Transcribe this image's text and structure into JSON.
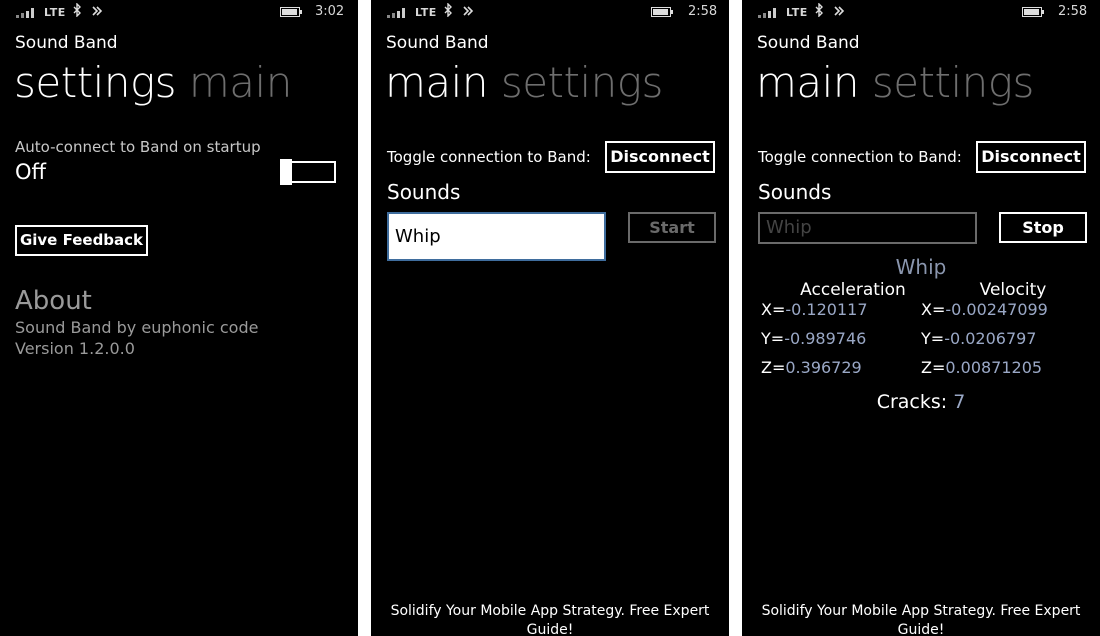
{
  "screens": [
    {
      "status": {
        "network": "LTE",
        "time": "3:02"
      },
      "app_title": "Sound Band",
      "pivot": {
        "active": "settings",
        "inactive": "main"
      },
      "autoconnect": {
        "label": "Auto-connect to Band on startup",
        "value": "Off"
      },
      "feedback_button": "Give Feedback",
      "about": {
        "title": "About",
        "line1": "Sound Band by euphonic code",
        "line2": "Version 1.2.0.0"
      }
    },
    {
      "status": {
        "network": "LTE",
        "time": "2:58"
      },
      "app_title": "Sound Band",
      "pivot": {
        "active": "main",
        "inactive": "settings"
      },
      "toggle_label": "Toggle connection to Band:",
      "disconnect_button": "Disconnect",
      "sounds_label": "Sounds",
      "sound_input_value": "Whip",
      "start_button": "Start",
      "ad_text": "Solidify Your Mobile App Strategy. Free Expert Guide!"
    },
    {
      "status": {
        "network": "LTE",
        "time": "2:58"
      },
      "app_title": "Sound Band",
      "pivot": {
        "active": "main",
        "inactive": "settings"
      },
      "toggle_label": "Toggle connection to Band:",
      "disconnect_button": "Disconnect",
      "sounds_label": "Sounds",
      "sound_input_value": "Whip",
      "stop_button": "Stop",
      "current_sound": "Whip",
      "acceleration": {
        "title": "Acceleration",
        "x": "-0.120117",
        "y": "-0.989746",
        "z": "0.396729"
      },
      "velocity": {
        "title": "Velocity",
        "x": "-0.00247099",
        "y": "-0.0206797",
        "z": "0.00871205"
      },
      "axis_labels": {
        "x": "X=",
        "y": "Y=",
        "z": "Z="
      },
      "cracks": {
        "label": "Cracks:",
        "value": "7"
      },
      "ad_text": "Solidify Your Mobile App Strategy. Free Expert Guide!"
    }
  ]
}
